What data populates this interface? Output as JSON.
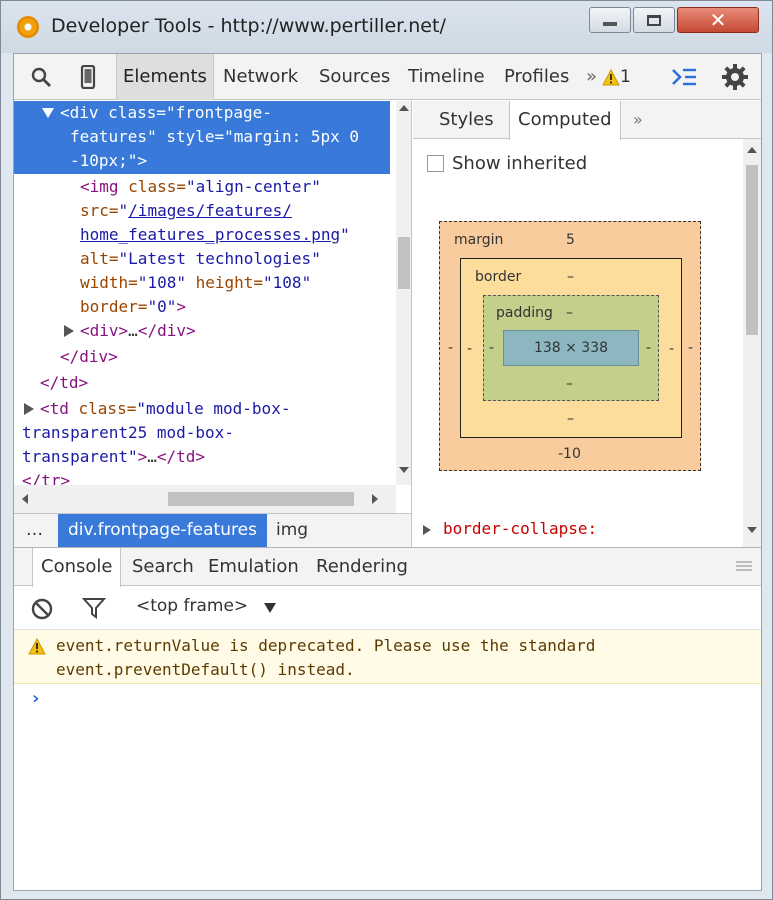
{
  "window": {
    "title": "Developer Tools - http://www.pertiller.net/",
    "close_glyph": "✕"
  },
  "toolbar": {
    "tabs": [
      "Elements",
      "Network",
      "Sources",
      "Timeline",
      "Profiles"
    ],
    "more": "»",
    "warning_count": "1",
    "icons": [
      "search-icon",
      "device-icon",
      "warning-icon",
      "drawer-toggle-icon",
      "gear-icon"
    ]
  },
  "elements": {
    "lines": [
      {
        "open": "<div ",
        "a1": "class=",
        "v1": "\"frontpage-"
      },
      {
        "v1": "features\"",
        "a2": " style=",
        "v2": "\"margin: 5px 0"
      },
      {
        "v2": "-10px;\"",
        "close": ">"
      },
      {
        "open": "<img ",
        "a1": "class=",
        "v1": "\"align-center\""
      },
      {
        "a1": "src=",
        "v1": "\"",
        "link": "/images/features/"
      },
      {
        "link": "home_features_processes.png",
        "v1": "\""
      },
      {
        "a1": "alt=",
        "v1": "\"Latest technologies\""
      },
      {
        "a1": "width=",
        "v1": "\"108\"",
        "a2": " height=",
        "v2": "\"108\""
      },
      {
        "a1": "border=",
        "v1": "\"0\"",
        "close": ">"
      },
      {
        "open": "<div>",
        "text": "…",
        "close": "</div>"
      },
      {
        "close": "</div>"
      },
      {
        "close": "</td>"
      },
      {
        "open": "<td ",
        "a1": "class=",
        "v1": "\"module mod-box-"
      },
      {
        "v1": "transparent25 mod-box-"
      },
      {
        "v1": "transparent\"",
        "close": ">",
        "text": "…",
        "close2": "</td>"
      },
      {
        "close": "</tr>"
      }
    ]
  },
  "breadcrumb": {
    "items": [
      "…",
      "div.frontpage-features",
      "img"
    ]
  },
  "sidebar": {
    "tabs": [
      "Styles",
      "Computed"
    ],
    "more": "»",
    "show_inherited": "Show inherited",
    "box": {
      "margin_label": "margin",
      "margin_top": "5",
      "margin_bottom": "-10",
      "margin_left": "-",
      "margin_right": "-",
      "border_label": "border",
      "border_top": "–",
      "border_bottom": "–",
      "border_left": "-",
      "border_right": "-",
      "padding_label": "padding",
      "padding_top": "–",
      "padding_bottom": "–",
      "padding_left": "-",
      "padding_right": "-",
      "content": "138 × 338"
    },
    "next_property": "border-collapse:"
  },
  "drawer": {
    "tabs": [
      "Console",
      "Search",
      "Emulation",
      "Rendering"
    ],
    "frame": "<top frame>",
    "message_line1": "event.returnValue is deprecated. Please use the standard",
    "message_line2": "event.preventDefault() instead.",
    "prompt": "›"
  }
}
